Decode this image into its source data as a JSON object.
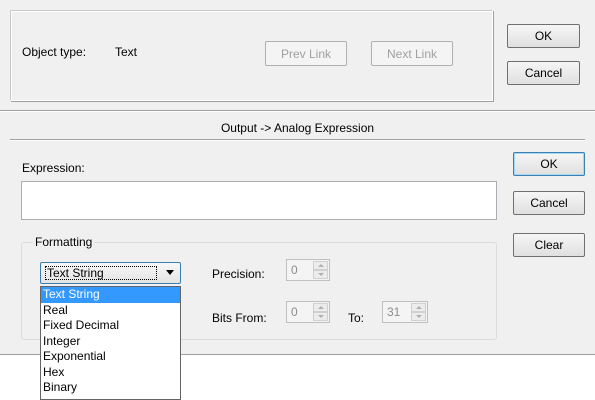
{
  "top": {
    "object_type_label": "Object type:",
    "object_type_value": "Text",
    "prev_link": "Prev Link",
    "next_link": "Next Link",
    "ok": "OK",
    "cancel": "Cancel"
  },
  "section": {
    "title": "Output -> Analog Expression"
  },
  "expression": {
    "label": "Expression:",
    "value": ""
  },
  "side_buttons": {
    "ok": "OK",
    "cancel": "Cancel",
    "clear": "Clear"
  },
  "formatting": {
    "legend": "Formatting",
    "selected": "Text String",
    "options": [
      "Text String",
      "Real",
      "Fixed Decimal",
      "Integer",
      "Exponential",
      "Hex",
      "Binary"
    ],
    "precision_label": "Precision:",
    "precision_value": "0",
    "bits_from_label": "Bits From:",
    "bits_from_value": "0",
    "to_label": "To:",
    "to_value": "31"
  }
}
